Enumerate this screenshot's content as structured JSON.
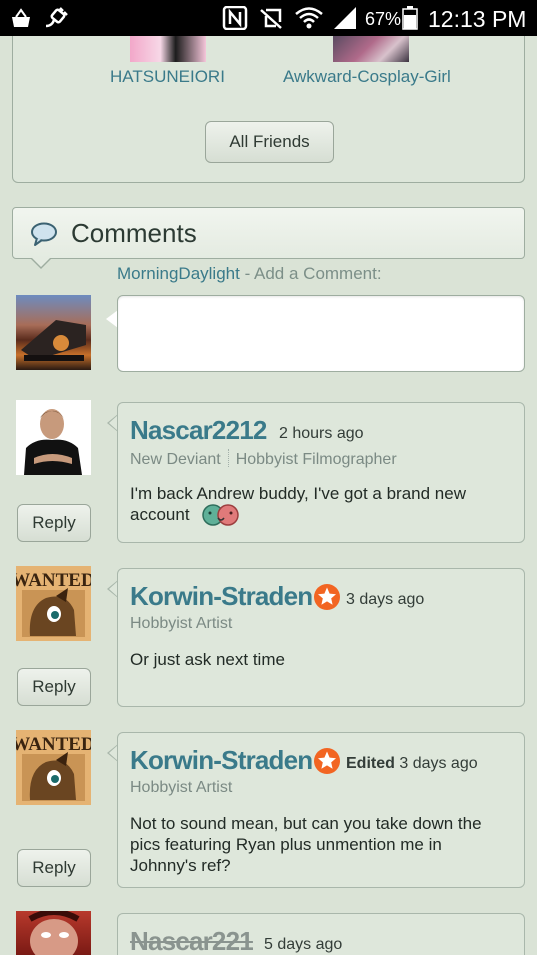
{
  "status_bar": {
    "battery": "67%",
    "time": "12:13 PM",
    "icons": [
      "shopping-bag-icon",
      "plug-icon",
      "nfc-icon",
      "vibrate-off-icon",
      "wifi-icon",
      "cell-signal-icon",
      "battery-icon"
    ]
  },
  "friends": {
    "items": [
      {
        "name": "HATSUNEIORI"
      },
      {
        "name": "Awkward-Cosplay-Girl"
      }
    ],
    "all_friends_label": "All Friends"
  },
  "comments": {
    "title": "Comments",
    "icon": "speech-bubble-icon",
    "current_user": "MorningDaylight",
    "add_comment": " - Add a Comment:",
    "input_value": "",
    "reply_label": "Reply",
    "list": [
      {
        "author": "Nascar2212",
        "time": "2 hours ago",
        "group": "New Deviant",
        "role": "Hobbyist Filmographer",
        "body": "I'm back Andrew buddy, I've got a brand new account",
        "emoji": "hugging-emoticon-icon"
      },
      {
        "author": "Korwin-Straden",
        "badge": "star-badge-icon",
        "time": "3 days ago",
        "role": "Hobbyist Artist",
        "body": "Or just ask next time"
      },
      {
        "author": "Korwin-Straden",
        "badge": "star-badge-icon",
        "edited": "Edited",
        "time": "3 days ago",
        "role": "Hobbyist Artist",
        "body": "Not to sound mean, but can you take down the pics featuring Ryan plus unmention me in Johnny's ref?"
      },
      {
        "author": "Nascar221",
        "time": "5 days ago"
      }
    ]
  },
  "colors": {
    "background": "#dae3d6",
    "link": "#3a7a8a",
    "star_badge": "#f26522"
  }
}
